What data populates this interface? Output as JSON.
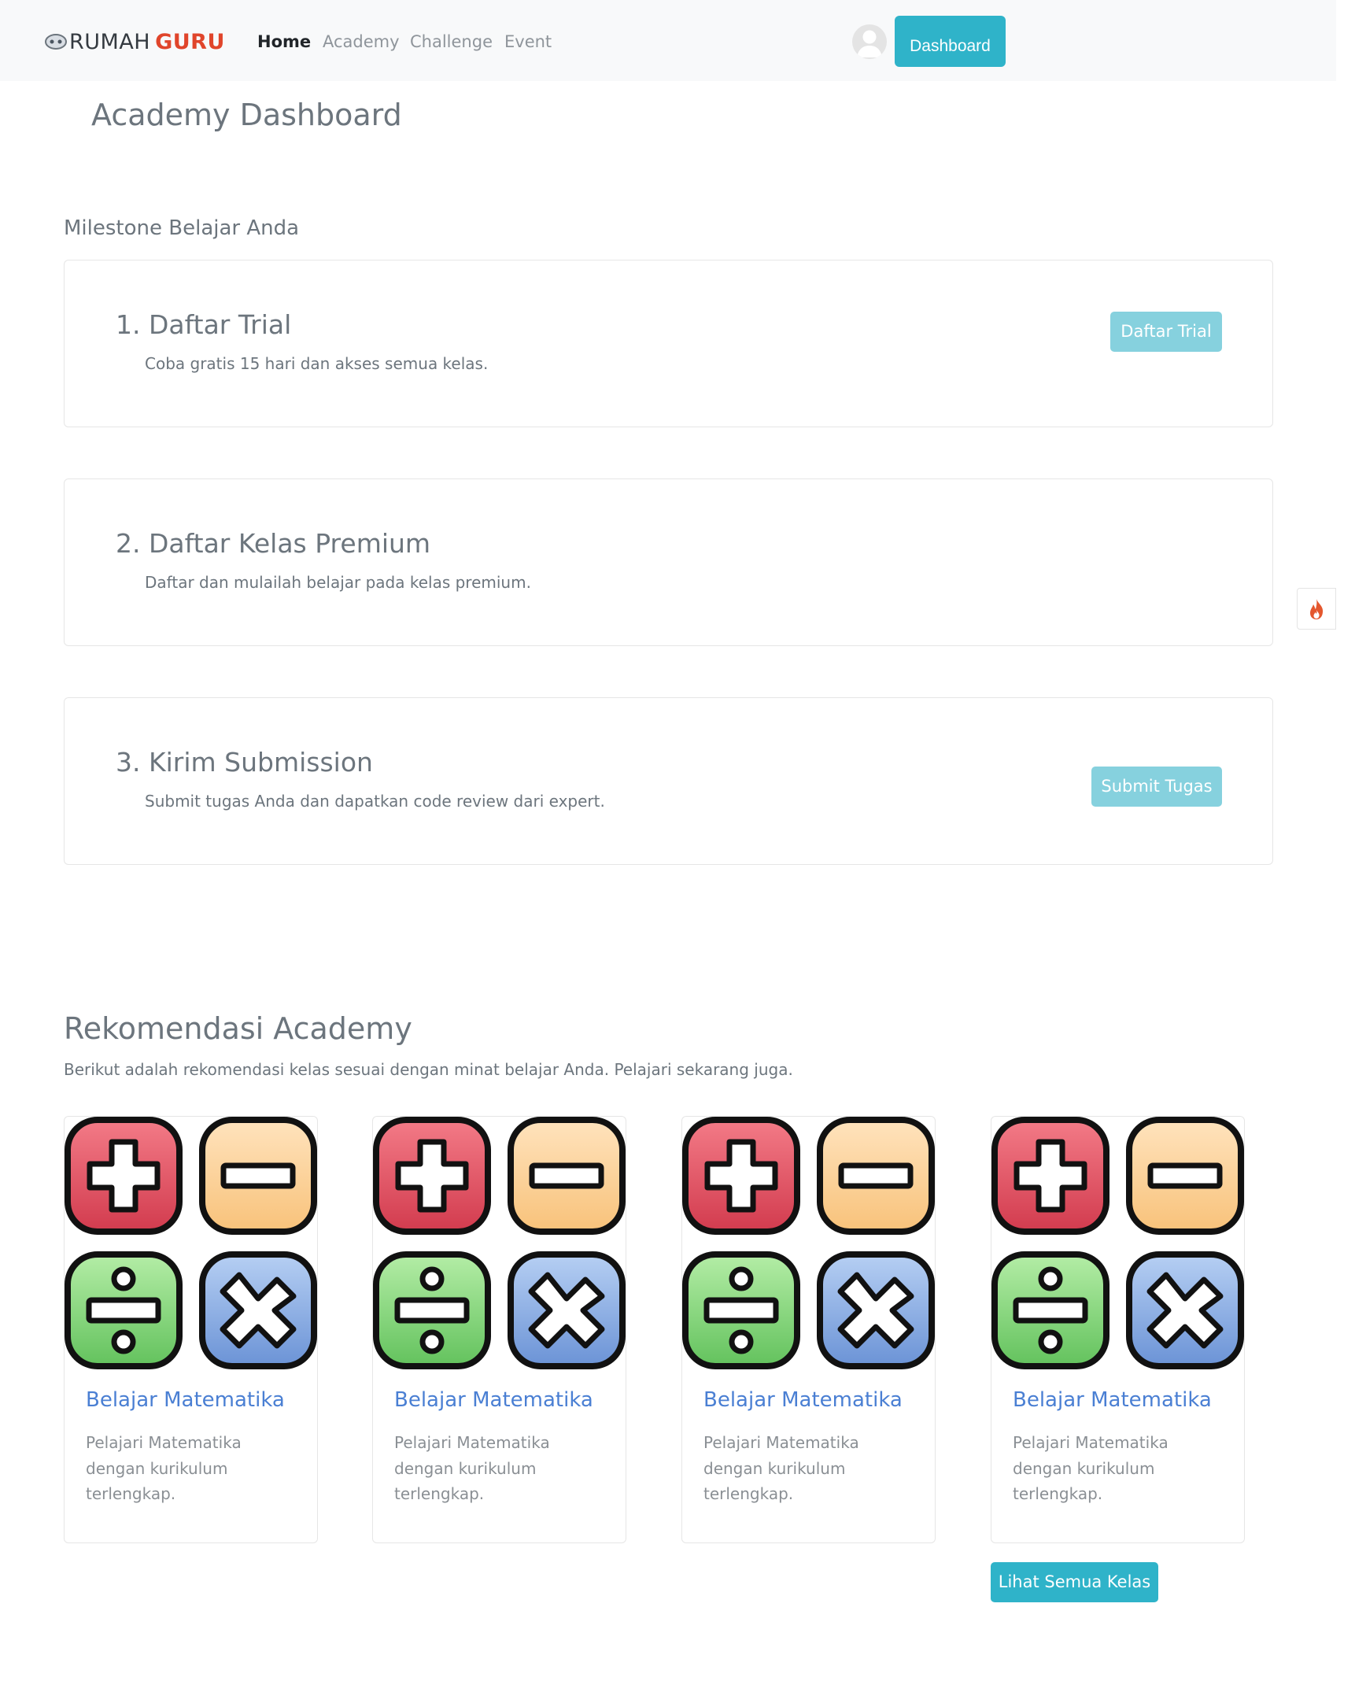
{
  "navbar": {
    "brand_part1": "RUMAH",
    "brand_part2": "GURU",
    "links": [
      {
        "label": "Home",
        "active": true
      },
      {
        "label": "Academy",
        "active": false
      },
      {
        "label": "Challenge",
        "active": false
      },
      {
        "label": "Event",
        "active": false
      }
    ],
    "dashboard_button": "Dashboard"
  },
  "page_title": "Academy Dashboard",
  "milestones": {
    "section_label": "Milestone Belajar Anda",
    "items": [
      {
        "title": "1. Daftar Trial",
        "description": "Coba gratis 15 hari dan akses semua kelas.",
        "button": "Daftar Trial"
      },
      {
        "title": "2. Daftar Kelas Premium",
        "description": "Daftar dan mulailah belajar pada kelas premium.",
        "button": null
      },
      {
        "title": "3. Kirim Submission",
        "description": "Submit tugas Anda dan dapatkan code review dari expert.",
        "button": "Submit Tugas"
      }
    ]
  },
  "recommendations": {
    "title": "Rekomendasi Academy",
    "description": "Berikut adalah rekomendasi kelas sesuai dengan minat belajar Anda. Pelajari sekarang juga.",
    "courses": [
      {
        "title": "Belajar Matematika",
        "description": "Pelajari Matematika dengan kurikulum terlengkap.",
        "image_icon": "math-operators-icon"
      },
      {
        "title": "Belajar Matematika",
        "description": "Pelajari Matematika dengan kurikulum terlengkap.",
        "image_icon": "math-operators-icon"
      },
      {
        "title": "Belajar Matematika",
        "description": "Pelajari Matematika dengan kurikulum terlengkap.",
        "image_icon": "math-operators-icon"
      },
      {
        "title": "Belajar Matematika",
        "description": "Pelajari Matematika dengan kurikulum terlengkap.",
        "image_icon": "math-operators-icon"
      }
    ],
    "view_all_button": "Lihat Semua Kelas"
  },
  "icons": {
    "brand": "shield-logo-icon",
    "avatar": "user-avatar-icon",
    "floating_tab": "fire-icon"
  },
  "colors": {
    "accent": "#2fb3c9",
    "accent_light": "#86d1de",
    "brand_red": "#e0452b",
    "course_title": "#4a7fd3"
  }
}
